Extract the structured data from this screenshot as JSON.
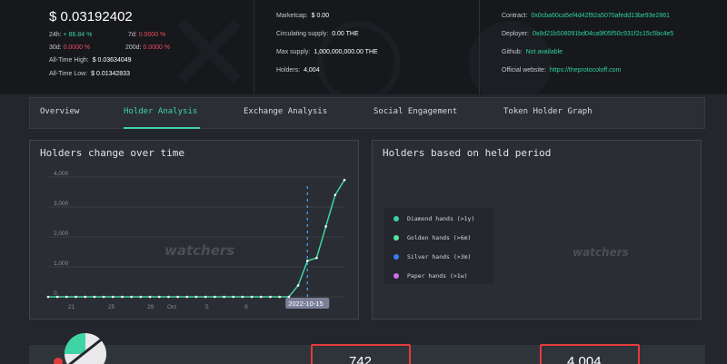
{
  "header": {
    "price": "$ 0.03192402",
    "changes": {
      "h24_label": "24h:",
      "h24_value": "+ 86.84 %",
      "d7_label": "7d:",
      "d7_value": "0.0000 %",
      "d30_label": "30d:",
      "d30_value": "0.0000 %",
      "d200_label": "200d:",
      "d200_value": "0.0000 %"
    },
    "ath_label": "All-Time High:",
    "ath_value": "$ 0.03634049",
    "atl_label": "All-Time Low:",
    "atl_value": "$ 0.01342833",
    "marketcap_label": "Marketcap:",
    "marketcap_value": "$ 0.00",
    "circ_label": "Circulating supply:",
    "circ_value": "0.00 THE",
    "max_label": "Max supply:",
    "max_value": "1,000,000,000.00 THE",
    "holders_label": "Holders:",
    "holders_value": "4,004",
    "contract_label": "Contract:",
    "contract_value": "0x0cba60ca5ef4d42f92a5070afedd13be93e2861",
    "deployer_label": "Deployer:",
    "deployer_value": "0x8d21b508091bd04ca9f05f50c931f2c15c5bc4e5",
    "github_label": "Github:",
    "github_value": "Not available",
    "website_label": "Official website:",
    "website_value": "https://theprotocoloff.com"
  },
  "tabs": [
    "Overview",
    "Holder Analysis",
    "Exchange Analysis",
    "Social Engagement",
    "Token Holder Graph"
  ],
  "panel_left": {
    "title": "Holders change over time",
    "watermark": "watchers"
  },
  "panel_right": {
    "title": "Holders based on held period",
    "watermark": "watchers",
    "legend": [
      {
        "label": "Diamond hands (>1y)",
        "color": "#3ad39f"
      },
      {
        "label": "Golden hands (>6m)",
        "color": "#56e39b"
      },
      {
        "label": "Silver hands (>3m)",
        "color": "#3b7cf4"
      },
      {
        "label": "Paper hands (>1w)",
        "color": "#d36df0"
      }
    ]
  },
  "bottom": {
    "value1": "742",
    "value2": "4,004"
  },
  "chart_data": {
    "type": "line",
    "x": [
      0,
      1,
      2,
      3,
      4,
      5,
      6,
      7,
      8,
      9,
      10,
      11,
      12,
      13,
      14,
      15,
      16,
      17,
      18,
      19,
      20,
      21,
      22,
      23,
      24,
      25,
      26,
      27,
      28,
      29,
      30,
      31
    ],
    "values": [
      0,
      0,
      0,
      0,
      0,
      0,
      0,
      0,
      0,
      0,
      0,
      0,
      0,
      0,
      0,
      0,
      0,
      0,
      0,
      0,
      0,
      0,
      0,
      0,
      0,
      0,
      0,
      380,
      1200,
      1300,
      2350,
      3400,
      3900
    ],
    "ylim": [
      0,
      4000
    ],
    "yticks": [
      "0",
      "1,000",
      "2,000",
      "3,000",
      "4,000"
    ],
    "xticks": [
      "21",
      "25",
      "29",
      "Oct",
      "5",
      "9"
    ],
    "tooltip": "2022-10-15",
    "series_color": "#3fd49c"
  }
}
